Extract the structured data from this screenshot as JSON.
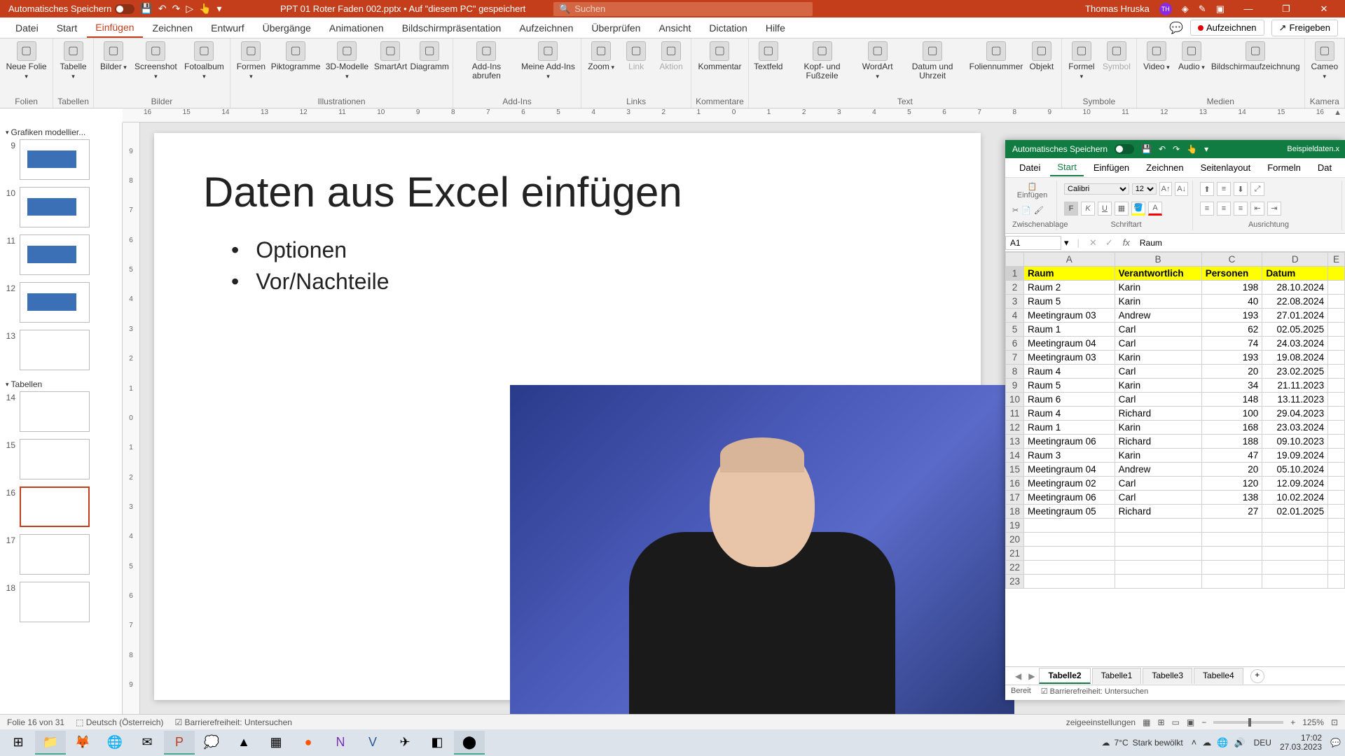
{
  "powerpoint": {
    "titlebar": {
      "autosave_label": "Automatisches Speichern",
      "doc_title": "PPT 01 Roter Faden 002.pptx • Auf \"diesem PC\" gespeichert",
      "search_placeholder": "Suchen",
      "user_name": "Thomas Hruska",
      "user_initials": "TH"
    },
    "tabs": [
      "Datei",
      "Start",
      "Einfügen",
      "Zeichnen",
      "Entwurf",
      "Übergänge",
      "Animationen",
      "Bildschirmpräsentation",
      "Aufzeichnen",
      "Überprüfen",
      "Ansicht",
      "Dictation",
      "Hilfe"
    ],
    "active_tab": "Einfügen",
    "ribbon_right": {
      "record": "Aufzeichnen",
      "share": "Freigeben"
    },
    "ribbon_groups": [
      {
        "label": "Folien",
        "items": [
          {
            "t": "Neue Folie",
            "arrow": true
          }
        ]
      },
      {
        "label": "Tabellen",
        "items": [
          {
            "t": "Tabelle",
            "arrow": true
          }
        ]
      },
      {
        "label": "Bilder",
        "items": [
          {
            "t": "Bilder",
            "arrow": true
          },
          {
            "t": "Screenshot",
            "arrow": true
          },
          {
            "t": "Fotoalbum",
            "arrow": true
          }
        ]
      },
      {
        "label": "Illustrationen",
        "items": [
          {
            "t": "Formen",
            "arrow": true
          },
          {
            "t": "Piktogramme"
          },
          {
            "t": "3D-Modelle",
            "arrow": true
          },
          {
            "t": "SmartArt"
          },
          {
            "t": "Diagramm"
          }
        ]
      },
      {
        "label": "Add-Ins",
        "items": [
          {
            "t": "Add-Ins abrufen"
          },
          {
            "t": "Meine Add-Ins",
            "arrow": true
          }
        ]
      },
      {
        "label": "Links",
        "items": [
          {
            "t": "Zoom",
            "arrow": true
          },
          {
            "t": "Link",
            "disabled": true
          },
          {
            "t": "Aktion",
            "disabled": true
          }
        ]
      },
      {
        "label": "Kommentare",
        "items": [
          {
            "t": "Kommentar"
          }
        ]
      },
      {
        "label": "Text",
        "items": [
          {
            "t": "Textfeld"
          },
          {
            "t": "Kopf- und Fußzeile"
          },
          {
            "t": "WordArt",
            "arrow": true
          },
          {
            "t": "Datum und Uhrzeit"
          },
          {
            "t": "Foliennummer"
          },
          {
            "t": "Objekt"
          }
        ]
      },
      {
        "label": "Symbole",
        "items": [
          {
            "t": "Formel",
            "arrow": true
          },
          {
            "t": "Symbol",
            "disabled": true
          }
        ]
      },
      {
        "label": "Medien",
        "items": [
          {
            "t": "Video",
            "arrow": true
          },
          {
            "t": "Audio",
            "arrow": true
          },
          {
            "t": "Bildschirmaufzeichnung"
          }
        ]
      },
      {
        "label": "Kamera",
        "items": [
          {
            "t": "Cameo",
            "arrow": true
          }
        ]
      }
    ],
    "hruler": [
      "16",
      "15",
      "14",
      "13",
      "12",
      "11",
      "10",
      "9",
      "8",
      "7",
      "6",
      "5",
      "4",
      "3",
      "2",
      "1",
      "0",
      "1",
      "2",
      "3",
      "4",
      "5",
      "6",
      "7",
      "8",
      "9",
      "10",
      "11",
      "12",
      "13",
      "14",
      "15",
      "16"
    ],
    "vruler": [
      "9",
      "8",
      "7",
      "6",
      "5",
      "4",
      "3",
      "2",
      "1",
      "0",
      "1",
      "2",
      "3",
      "4",
      "5",
      "6",
      "7",
      "8",
      "9"
    ],
    "sections": {
      "sec1": "Grafiken modellier...",
      "sec2": "Tabellen"
    },
    "thumbs": [
      {
        "n": "9"
      },
      {
        "n": "10"
      },
      {
        "n": "11"
      },
      {
        "n": "12"
      },
      {
        "n": "13"
      },
      {
        "n": "14"
      },
      {
        "n": "15"
      },
      {
        "n": "16",
        "sel": true
      },
      {
        "n": "17"
      },
      {
        "n": "18"
      }
    ],
    "slide": {
      "title": "Daten aus Excel einfügen",
      "bullets": [
        "Optionen",
        "Vor/Nachteile"
      ]
    },
    "status": {
      "slide_of": "Folie 16 von 31",
      "language": "Deutsch (Österreich)",
      "a11y": "Barrierefreiheit: Untersuchen",
      "notes": "zeigeeinstellungen",
      "zoom": "125%"
    }
  },
  "excel": {
    "titlebar": {
      "autosave_label": "Automatisches Speichern",
      "filename": "Beispieldaten.x"
    },
    "tabs": [
      "Datei",
      "Start",
      "Einfügen",
      "Zeichnen",
      "Seitenlayout",
      "Formeln",
      "Dat"
    ],
    "active_tab": "Start",
    "ribbon": {
      "clipboard_label": "Zwischenablage",
      "paste": "Einfügen",
      "font_label": "Schriftart",
      "font_name": "Calibri",
      "font_size": "12",
      "align_label": "Ausrichtung"
    },
    "namebox": {
      "ref": "A1",
      "formula": "Raum"
    },
    "columns": [
      "A",
      "B",
      "C",
      "D",
      "E"
    ],
    "headers": [
      "Raum",
      "Verantwortlich",
      "Personen",
      "Datum"
    ],
    "rows": [
      [
        "Raum 2",
        "Karin",
        "198",
        "28.10.2024"
      ],
      [
        "Raum 5",
        "Karin",
        "40",
        "22.08.2024"
      ],
      [
        "Meetingraum 03",
        "Andrew",
        "193",
        "27.01.2024"
      ],
      [
        "Raum 1",
        "Carl",
        "62",
        "02.05.2025"
      ],
      [
        "Meetingraum 04",
        "Carl",
        "74",
        "24.03.2024"
      ],
      [
        "Meetingraum 03",
        "Karin",
        "193",
        "19.08.2024"
      ],
      [
        "Raum 4",
        "Carl",
        "20",
        "23.02.2025"
      ],
      [
        "Raum 5",
        "Karin",
        "34",
        "21.11.2023"
      ],
      [
        "Raum 6",
        "Carl",
        "148",
        "13.11.2023"
      ],
      [
        "Raum 4",
        "Richard",
        "100",
        "29.04.2023"
      ],
      [
        "Raum 1",
        "Karin",
        "168",
        "23.03.2024"
      ],
      [
        "Meetingraum 06",
        "Richard",
        "188",
        "09.10.2023"
      ],
      [
        "Raum 3",
        "Karin",
        "47",
        "19.09.2024"
      ],
      [
        "Meetingraum 04",
        "Andrew",
        "20",
        "05.10.2024"
      ],
      [
        "Meetingraum 02",
        "Carl",
        "120",
        "12.09.2024"
      ],
      [
        "Meetingraum 06",
        "Carl",
        "138",
        "10.02.2024"
      ],
      [
        "Meetingraum 05",
        "Richard",
        "27",
        "02.01.2025"
      ]
    ],
    "empty_rows": [
      "19",
      "20",
      "21",
      "22",
      "23"
    ],
    "sheets": [
      "Tabelle2",
      "Tabelle1",
      "Tabelle3",
      "Tabelle4"
    ],
    "active_sheet": "Tabelle2",
    "status": {
      "ready": "Bereit",
      "a11y": "Barrierefreiheit: Untersuchen"
    }
  },
  "taskbar": {
    "weather_temp": "7°C",
    "weather_text": "Stark bewölkt",
    "lang": "DEU",
    "time": "17:02",
    "date": "27.03.2023"
  }
}
